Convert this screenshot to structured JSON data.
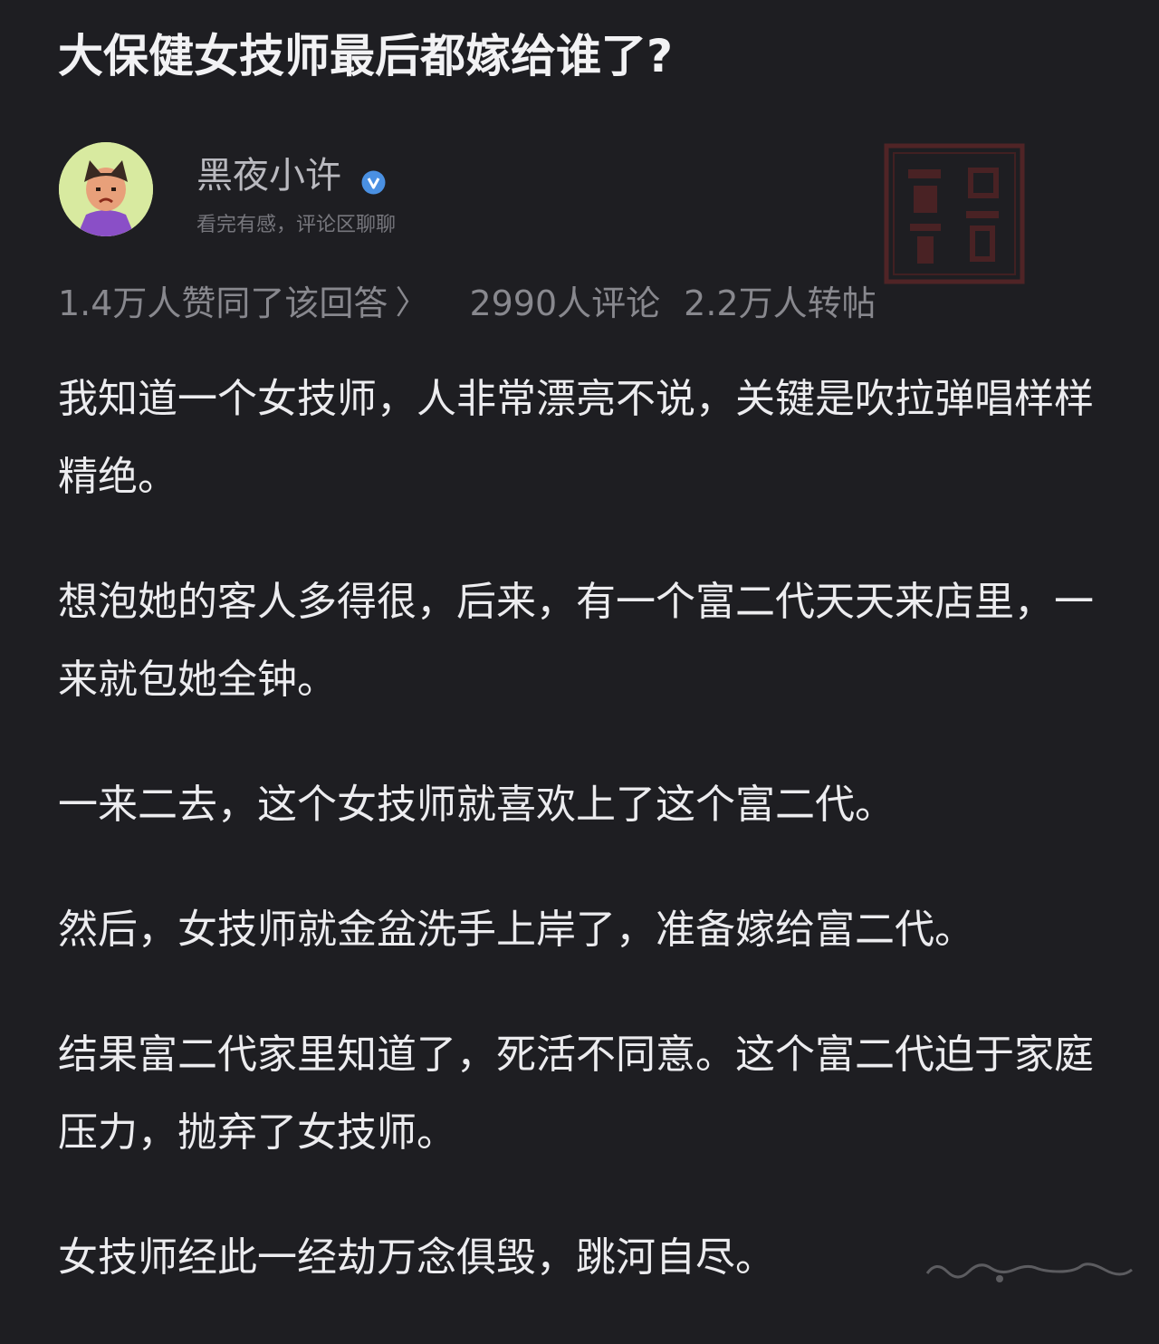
{
  "post": {
    "title": "大保健女技师最后都嫁给谁了?"
  },
  "author": {
    "name": "黑夜小许",
    "bio": "看完有感，评论区聊聊",
    "verified_icon": "verified-badge-icon",
    "avatar_icon": "cartoon-avatar-icon"
  },
  "seal": {
    "icon": "red-seal-stamp-icon",
    "color": "#7a2a2a"
  },
  "stats": {
    "likes": "1.4万人赞同了该回答",
    "chevron": "〉",
    "comments": "2990人评论",
    "reposts": "2.2万人转帖"
  },
  "content": {
    "paragraphs": [
      "我知道一个女技师，人非常漂亮不说，关键是吹拉弹唱样样精绝。",
      "想泡她的客人多得很，后来，有一个富二代天天来店里，一来就包她全钟。",
      "一来二去，这个女技师就喜欢上了这个富二代。",
      "然后，女技师就金盆洗手上岸了，准备嫁给富二代。",
      "结果富二代家里知道了，死活不同意。这个富二代迫于家庭压力，抛弃了女技师。",
      "女技师经此一经劫万念俱毁，跳河自尽。"
    ]
  },
  "colors": {
    "background": "#1e1e22",
    "text": "#ececef",
    "muted": "#88888e",
    "verified": "#4a90e2"
  }
}
